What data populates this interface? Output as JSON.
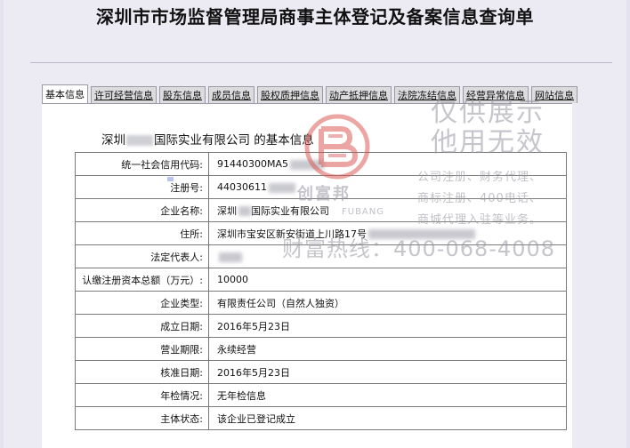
{
  "page": {
    "title": "深圳市市场监督管理局商事主体登记及备案信息查询单"
  },
  "tabs": [
    {
      "label": "基本信息",
      "active": true
    },
    {
      "label": "许可经营信息"
    },
    {
      "label": "股东信息"
    },
    {
      "label": "成员信息"
    },
    {
      "label": "股权质押信息"
    },
    {
      "label": "动产抵押信息"
    },
    {
      "label": "法院冻结信息"
    },
    {
      "label": "经营异常信息"
    },
    {
      "label": "网站信息"
    }
  ],
  "company": {
    "heading_prefix": "深圳",
    "heading_suffix": "国际实业有限公司  的基本信息"
  },
  "fields": [
    {
      "label": "统一社会信用代码:",
      "value": "91440300MA5"
    },
    {
      "label": "注册号:",
      "value": "44030611"
    },
    {
      "label": "企业名称:",
      "value": "深圳",
      "value_suffix": "国际实业有限公司"
    },
    {
      "label": "住所:",
      "value": "深圳市宝安区新安街道上川路17号"
    },
    {
      "label": "法定代表人:",
      "value": ""
    },
    {
      "label": "认缴注册资本总额（万元）:",
      "value": "10000"
    },
    {
      "label": "企业类型:",
      "value": "有限责任公司（自然人独资）"
    },
    {
      "label": "成立日期:",
      "value": "2016年5月23日"
    },
    {
      "label": "营业期限:",
      "value": "永续经营"
    },
    {
      "label": "核准日期:",
      "value": "2016年5月23日"
    },
    {
      "label": "年检情况:",
      "value": "无年检信息"
    },
    {
      "label": "主体状态:",
      "value": "该企业已登记成立"
    }
  ],
  "watermark": {
    "brand_cn": "创富邦",
    "brand_en": "FUBANG",
    "line1": "仅供展示",
    "line2": "他用无效",
    "services1": "公司注册、财务代理、",
    "services2": "商标注册、400电话、",
    "services3": "商城代理入驻等业务。",
    "hotline": "财富热线：400-068-4008",
    "color": "#c0392b"
  }
}
